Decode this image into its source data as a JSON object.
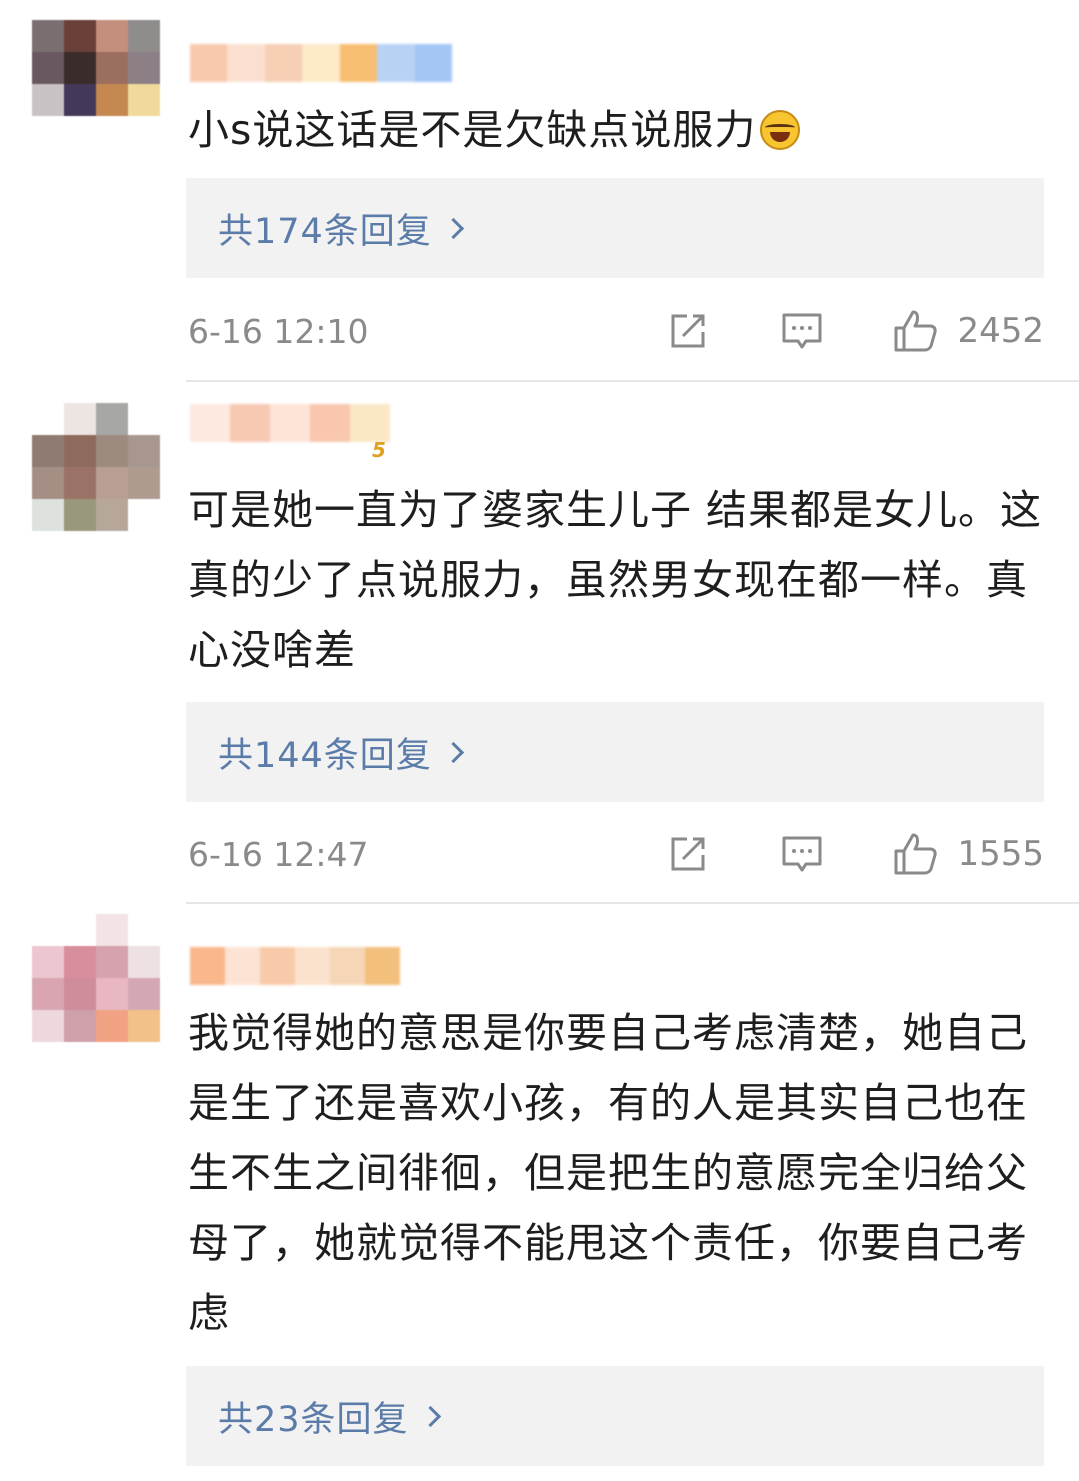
{
  "comments": [
    {
      "text": "小s说这话是不是欠缺点说服力",
      "emoji": "laughing-with-tears-emoji",
      "replies_label": "共174条回复",
      "time": "6-16 12:10",
      "likes": "2452"
    },
    {
      "text": "可是她一直为了婆家生儿子 结果都是女儿。这真的少了点说服力，虽然男女现在都一样。真心没啥差",
      "level_badge": "5",
      "replies_label": "共144条回复",
      "time": "6-16 12:47",
      "likes": "1555"
    },
    {
      "text": "我觉得她的意思是你要自己考虑清楚，她自己是生了还是喜欢小孩，有的人是其实自己也在生不生之间徘徊，但是把生的意愿完全归给父母了，她就觉得不能甩这个责任，你要自己考虑",
      "replies_label": "共23条回复"
    }
  ],
  "icons": {
    "share": "share-icon",
    "comment": "comment-icon",
    "like": "thumbs-up-icon",
    "chevron": "chevron-right-icon"
  },
  "colors": {
    "link": "#5b7ca8",
    "meta": "#8a8a8a",
    "reply_bg": "#f2f2f2"
  }
}
